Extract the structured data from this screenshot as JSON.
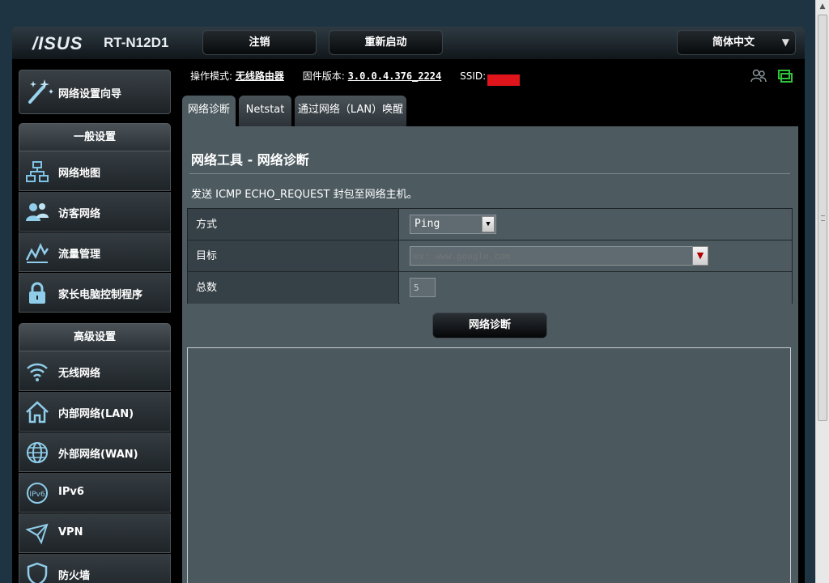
{
  "header": {
    "brand": "/ISUS",
    "model": "RT-N12D1",
    "logout_label": "注销",
    "reboot_label": "重新启动",
    "language": "简体中文"
  },
  "sidebar": {
    "wizard_label": "网络设置向导",
    "general_title": "一般设置",
    "general_items": [
      {
        "label": "网络地图",
        "icon": "network-map-icon"
      },
      {
        "label": "访客网络",
        "icon": "guest-network-icon"
      },
      {
        "label": "流量管理",
        "icon": "traffic-icon"
      },
      {
        "label": "家长电脑控制程序",
        "icon": "lock-icon"
      }
    ],
    "advanced_title": "高级设置",
    "advanced_items": [
      {
        "label": "无线网络",
        "icon": "wifi-icon"
      },
      {
        "label": "内部网络(LAN)",
        "icon": "home-icon"
      },
      {
        "label": "外部网络(WAN)",
        "icon": "globe-icon"
      },
      {
        "label": "IPv6",
        "icon": "ipv6-icon"
      },
      {
        "label": "VPN",
        "icon": "vpn-icon"
      },
      {
        "label": "防火墙",
        "icon": "shield-icon"
      }
    ]
  },
  "status": {
    "mode_label": "操作模式:",
    "mode_value": "无线路由器",
    "firmware_label": "固件版本:",
    "firmware_value": "3.0.0.4.376_2224",
    "ssid_label": "SSID:",
    "ssid_value": "___"
  },
  "tabs": [
    {
      "label": "网络诊断",
      "active": true
    },
    {
      "label": "Netstat",
      "active": false
    },
    {
      "label": "通过网络（LAN）唤醒",
      "active": false
    }
  ],
  "panel": {
    "title": "网络工具 - 网络诊断",
    "description": "发送 ICMP ECHO_REQUEST 封包至网络主机。",
    "rows": {
      "method_label": "方式",
      "method_value": "Ping",
      "target_label": "目标",
      "target_placeholder": "ex: www.google.com",
      "count_label": "总数",
      "count_value": "5"
    },
    "button_label": "网络诊断",
    "result_text": ""
  },
  "colors": {
    "background": "#1f3443",
    "panel": "#4d5b61",
    "label_cell": "#364147",
    "ssid_mask": "#e0151b",
    "status_icon_green": "#2fc439"
  }
}
